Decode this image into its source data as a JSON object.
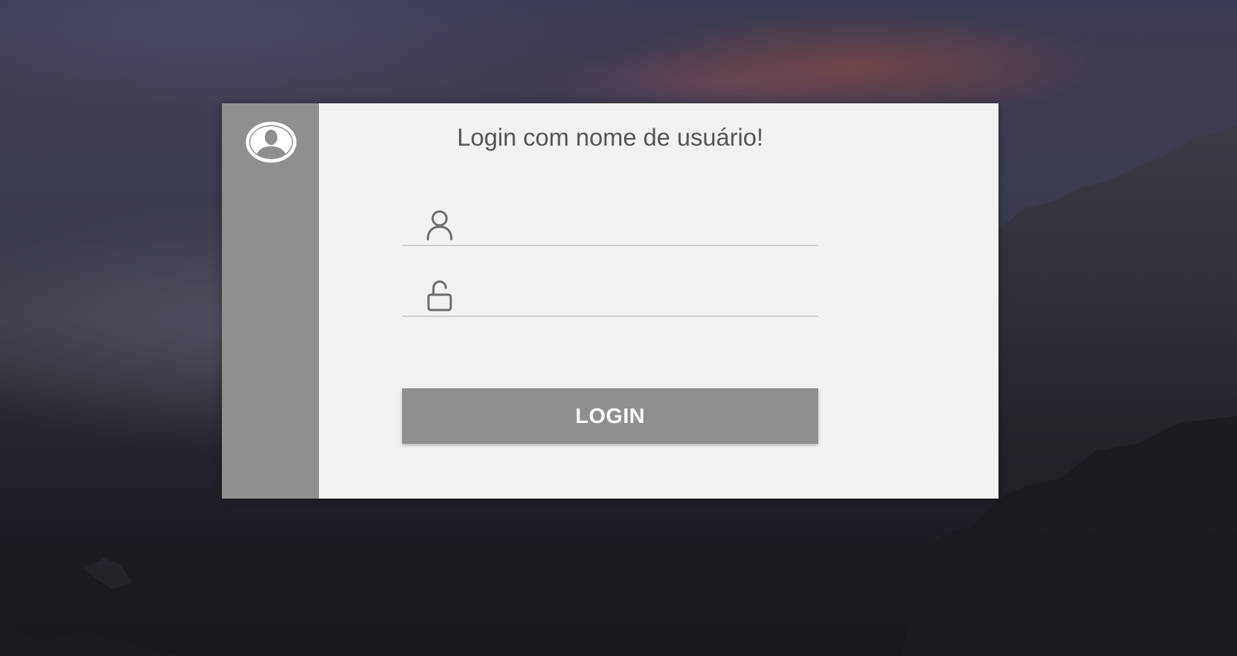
{
  "login_dialog": {
    "title": "Login com nome de usuário!",
    "username_field": {
      "value": "",
      "placeholder": "",
      "icon": "user-outline-icon"
    },
    "password_field": {
      "value": "",
      "placeholder": "",
      "icon": "unlocked-padlock-icon"
    },
    "login_button": {
      "label": "LOGIN"
    },
    "sidebar": {
      "icon": "user-avatar-icon"
    }
  },
  "colors": {
    "sidebar": "#8f8f8f",
    "panel": "#f2f2f2",
    "button": "#8f8f8f",
    "button_text": "#ffffff",
    "title_text": "#555555",
    "icon": "#6e6e6e",
    "underline": "#cfcfcf"
  }
}
